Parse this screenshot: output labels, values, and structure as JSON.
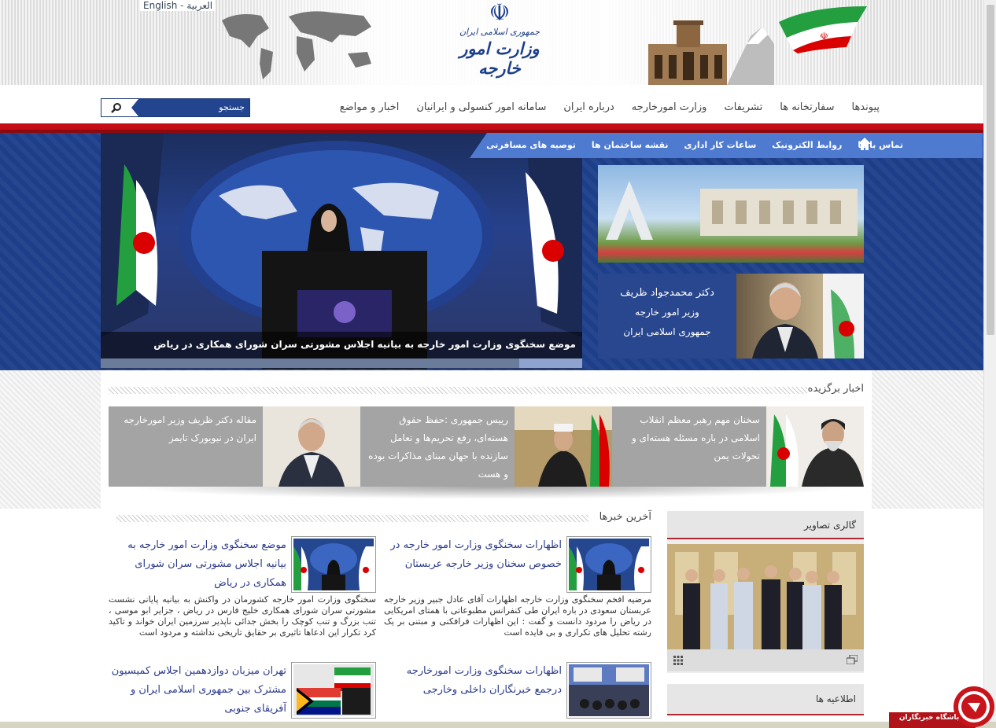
{
  "header": {
    "lang_en": "English",
    "lang_sep": "-",
    "lang_ar": "العربية",
    "logo_line1": "جمهوری اسلامی ایران",
    "logo_line2": "وزارت امور خارجه"
  },
  "nav": {
    "items": [
      "اخبار و مواضع",
      "سامانه امور کنسولی و ایرانیان",
      "درباره ایران",
      "وزارت امورخارجه",
      "تشریفات",
      "سفارتخانه ها",
      "پیوندها"
    ]
  },
  "search": {
    "placeholder": "جستجو"
  },
  "subnav": {
    "items": [
      "توصیه های مسافرتی",
      "نقشه ساختمان ها",
      "ساعات کار اداری",
      "روابط الکترونیک",
      "تماس با ما"
    ]
  },
  "slider": {
    "caption": "موضع سخنگوی وزارت امور خارجه به بیانیه اجلاس مشورتی سران شورای همکاری در ریاض"
  },
  "minister": {
    "name": "دکتر محمدجواد ظریف",
    "title": "وزیر امور خارجه",
    "country": "جمهوری اسلامی ایران"
  },
  "featured": {
    "title": "اخبار برگزیده",
    "cards": [
      {
        "text": "سخنان مهم رهبر معظم انقلاب اسلامی در باره مسئله هسته‌ای و تحولات یمن"
      },
      {
        "text": "رییس جمهوری :حفظ حقوق هسته‌ای، رفع تحریم‌ها و تعامل سازنده با جهان مبنای مذاکرات بوده و هست"
      },
      {
        "text": "مقاله دکتر ظریف وزیر امورخارجه ایران در نیویورک تایمز"
      }
    ]
  },
  "latest": {
    "title": "آخرین خبرها",
    "items": [
      {
        "title": "اظهارات سخنگوی وزارت امور خارجه در خصوص سخنان وزیر خارجه عربستان",
        "desc": "مرضیه افخم سخنگوی وزارت خارجه اظهارات آقای عادل جبیر وزیر خارجه عربستان سعودی در باره ایران طی کنفرانس مطبوعاتی با همتای امریکایی در ریاض را مردود دانست و گفت : این اظهارات فرافکنی و مبتنی بر یک رشته تحلیل های تکراری و بی فایده است"
      },
      {
        "title": "موضع سخنگوی وزارت امور خارجه به بیانیه اجلاس مشورتی سران شورای همکاری در ریاض",
        "desc": "سخنگوی وزارت امور خارجه کشورمان در واکنش به بیانیه پایانی نشست مشورتی سران شورای همکاری خلیج فارس در ریاض ، جزایر ابو موسی ، تنب بزرگ و تنب کوچک را بخش جدائی ناپذیر سرزمین ایران خواند و تاکید کرد تکرار این ادعاها تاثیری بر حقایق تاریخی نداشته و مردود است"
      },
      {
        "title": "اظهارات سخنگوی وزارت امورخارجه درجمع خبرنگاران داخلی وخارجی",
        "desc": ""
      },
      {
        "title": "تهران میزبان دوازدهمین اجلاس کمیسیون مشترک بین جمهوری اسلامی ایران و آفریقای جنوبی",
        "desc": ""
      }
    ]
  },
  "gallery": {
    "title": "گالری تصاویر"
  },
  "announcements": {
    "title": "اطلاعیه ها"
  },
  "badge": {
    "text": "باشگاه خبرنگاران"
  },
  "colors": {
    "brand_blue": "#1d3f8a",
    "red": "#c40d15",
    "subnav": "#4e7ad0"
  }
}
